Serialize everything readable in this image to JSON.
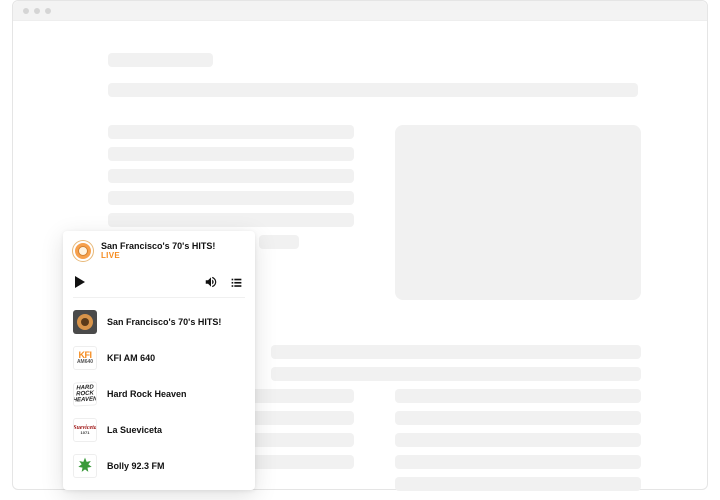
{
  "player": {
    "now_playing": {
      "title": "San Francisco's 70's HITS!",
      "status": "LIVE"
    },
    "stations": [
      {
        "name": "San Francisco's 70's HITS!",
        "art": "sf"
      },
      {
        "name": "KFI AM 640",
        "art": "kfi"
      },
      {
        "name": "Hard Rock Heaven",
        "art": "hrh"
      },
      {
        "name": "La Sueviceta",
        "art": "sueviceta"
      },
      {
        "name": "Bolly 92.3 FM",
        "art": "bolly"
      }
    ]
  }
}
